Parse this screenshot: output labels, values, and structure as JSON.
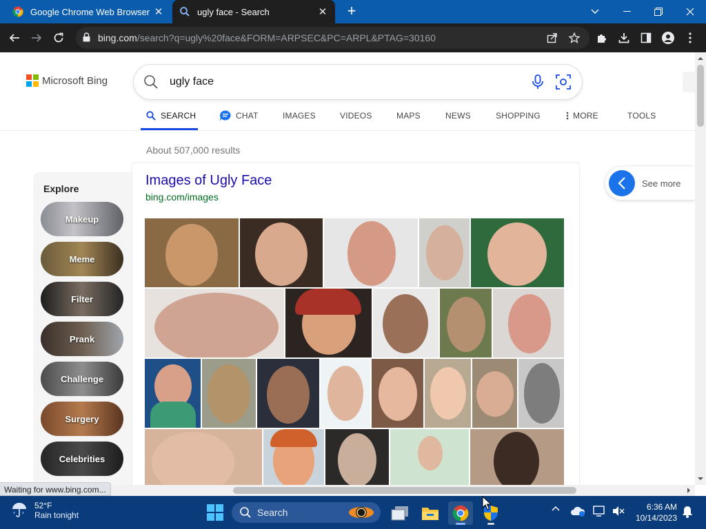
{
  "browser": {
    "tabs": [
      {
        "title": "Google Chrome Web Browser",
        "active": false
      },
      {
        "title": "ugly face - Search",
        "active": true
      }
    ],
    "url_host": "bing.com",
    "url_rest": "/search?q=ugly%20face&FORM=ARPSEC&PC=ARPL&PTAG=30160"
  },
  "bing": {
    "logo_text": "Microsoft Bing",
    "query": "ugly face",
    "nav": [
      "SEARCH",
      "CHAT",
      "IMAGES",
      "VIDEOS",
      "MAPS",
      "NEWS",
      "SHOPPING",
      "MORE",
      "TOOLS"
    ],
    "result_count": "About 507,000 results"
  },
  "explore": {
    "heading": "Explore",
    "items": [
      "Makeup",
      "Meme",
      "Filter",
      "Prank",
      "Challenge",
      "Surgery",
      "Celebrities"
    ]
  },
  "images_card": {
    "title": "Images of Ugly Face",
    "url": "bing.com/images",
    "see_more": "See more"
  },
  "status_text": "Waiting for www.bing.com...",
  "taskbar": {
    "temperature": "52°F",
    "forecast": "Rain tonight",
    "search_label": "Search",
    "time": "6:36 AM",
    "date": "10/14/2023"
  },
  "colors": {
    "chrome_tabstrip": "#0b5cad",
    "chrome_toolbar": "#1f1f1f",
    "bing_link": "#1a0dab",
    "bing_url": "#006d21",
    "bing_accent": "#174ae4",
    "taskbar": "#0a3c7c"
  }
}
